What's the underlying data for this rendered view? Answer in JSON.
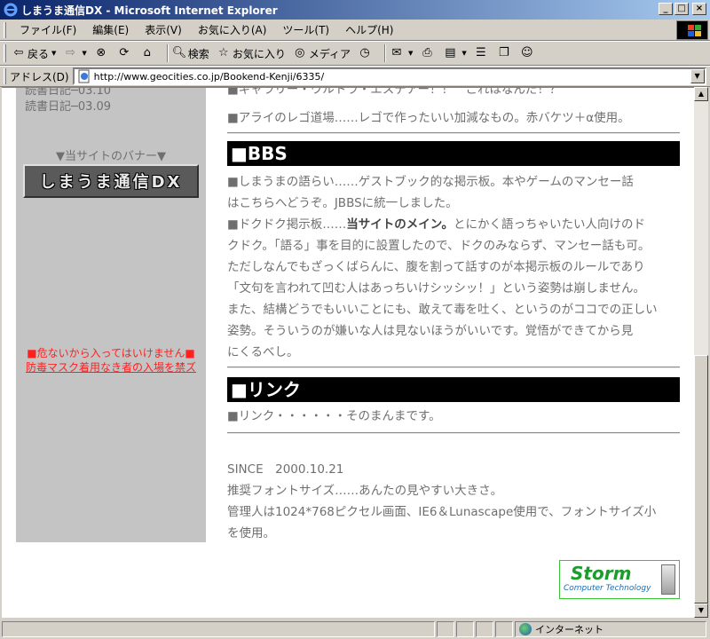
{
  "window": {
    "title": "しまうま通信DX - Microsoft Internet Explorer"
  },
  "menu": [
    "ファイル(F)",
    "編集(E)",
    "表示(V)",
    "お気に入り(A)",
    "ツール(T)",
    "ヘルプ(H)"
  ],
  "toolbar": {
    "back": "戻る",
    "search": "検索",
    "favorites": "お気に入り",
    "media": "メディア"
  },
  "address": {
    "label": "アドレス(D)",
    "url": "http://www.geocities.co.jp/Bookend-Kenji/6335/"
  },
  "sidebar": {
    "diary_clip": "読書日記─03.10",
    "diary": "読書日記─03.09",
    "banner_title": "▼当サイトのバナー▼",
    "banner_text": "しまうま通信DX",
    "warning1": "■危ないから入ってはいけません■",
    "warning2": "防毒マスク着用なき者の入場を禁ズ"
  },
  "content": {
    "clipped_line": "■ギャラリー・ウルトラ・エスデアー！！　これはなんだ！？",
    "lego_line": "■アライのレゴ道場……レゴで作ったいい加減なもの。赤バケツ＋α使用。",
    "bbs_heading": "■BBS",
    "bbs_lines": [
      "■しまうまの語らい……ゲストブック的な掲示板。本やゲームのマンセー話",
      "はこちらへどうぞ。JBBSに統一しました。"
    ],
    "dokudoku_prefix": "■ドクドク掲示板……",
    "dokudoku_bold": "当サイトのメイン。",
    "dokudoku_rest": "とにかく語っちゃいたい人向けのド",
    "dokudoku_lines": [
      "クドク。「語る」事を目的に設置したので、ドクのみならず、マンセー話も可。",
      "ただしなんでもざっくばらんに、腹を割って話すのが本掲示板のルールであり",
      "「文句を言われて凹む人はあっちいけシッシッ！」という姿勢は崩しません。",
      "また、結構どうでもいいことにも、敢えて毒を吐く、というのがココでの正しい",
      "姿勢。そういうのが嫌いな人は見ないほうがいいです。覚悟ができてから見",
      "にくるべし。"
    ],
    "link_heading": "■リンク",
    "link_line": "■リンク・・・・・・そのまんまです。",
    "since": "SINCE　2000.10.21",
    "font_line": "推奨フォントサイズ……あんたの見やすい大きさ。",
    "admin_lines": [
      "管理人は1024*768ピクセル画面、IE6＆Lunascape使用で、フォントサイズ小",
      "を使用。"
    ]
  },
  "storm_logo": {
    "name": "Storm",
    "sub": "Computer Technology"
  },
  "status": {
    "zone": "インターネット"
  }
}
